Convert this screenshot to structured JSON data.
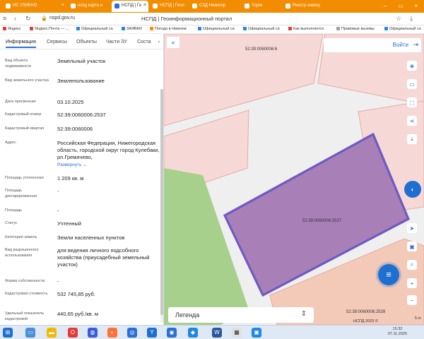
{
  "browser": {
    "tabs": [
      {
        "label": "ИС УЗИКНО"
      },
      {
        "label": "нспд карта н"
      },
      {
        "label": "НСПД | Ге",
        "active": true
      },
      {
        "label": "НСПД | Геоп"
      },
      {
        "label": "СЗД Нижегор"
      },
      {
        "label": "Торги"
      },
      {
        "label": "Реестр извещ"
      }
    ],
    "url": "nspd.gov.ru",
    "page_title": "НСПД | Геоинформационный портал",
    "bookmarks": [
      {
        "label": "Яндекс",
        "color": "#e53935"
      },
      {
        "label": "Яндекс.Почта — ...",
        "color": "#e53935"
      },
      {
        "label": "Официальный са",
        "color": "#1e88e5"
      },
      {
        "label": "ЗАЯВКИ",
        "color": "#1e88e5"
      },
      {
        "label": "Погода в Нижнем",
        "color": "#fb8c00"
      },
      {
        "label": "Официальный са",
        "color": "#1e88e5"
      },
      {
        "label": "Официальный са",
        "color": "#1e88e5"
      },
      {
        "label": "Как выполняется",
        "color": "#e53935"
      },
      {
        "label": "Правовые вызовы",
        "color": "#9e9e9e"
      },
      {
        "label": "Официальный са",
        "color": "#1e88e5"
      }
    ]
  },
  "panel": {
    "tabs": [
      "Информация",
      "Сервисы",
      "Объекты",
      "Части ЗУ",
      "Соста"
    ],
    "more": "›",
    "fields": [
      {
        "label": "Вид объекта недвижимости",
        "value": "Земельный участок"
      },
      {
        "label": "Вид земельного участка",
        "value": "Землепользование"
      },
      {
        "label": "Дата присвоения",
        "value": "03.10.2025"
      },
      {
        "label": "Кадастровый номер",
        "value": "52:39:0060006:2537"
      },
      {
        "label": "Кадастровый квартал",
        "value": "52:39:0060006"
      },
      {
        "label": "Адрес",
        "value": "Российская Федерация, Нижегородская область, городской округ город Кулебаки, рп.Гремячево,",
        "extra": "Развернуть"
      },
      {
        "label": "Площадь уточненная",
        "value": "1 209 кв. м"
      },
      {
        "label": "Площадь декларированная",
        "value": "-"
      },
      {
        "label": "Площадь",
        "value": "-"
      },
      {
        "label": "Статус",
        "value": "Учтенный"
      },
      {
        "label": "Категория земель",
        "value": "Земли населенных пунктов"
      },
      {
        "label": "Вид разрешенного использования",
        "value": "для ведения личного подсобного хозяйства (приусадебный земельный участок)"
      },
      {
        "label": "Форма собственности",
        "value": "-"
      },
      {
        "label": "Кадастровая стоимость",
        "value": "532 745,85 руб."
      },
      {
        "label": "Удельный показатель кадастровой",
        "value": "440,65 руб./кв. м"
      }
    ]
  },
  "map": {
    "login_label": "Войти",
    "collapse_icon": "«",
    "legend_label": "Легенда",
    "parcel_labels": {
      "top": "52:39:0060006:6",
      "selected": "52:39:0060006:2537",
      "bottom": "52:39:0060006:2539"
    },
    "credit": "НСПД 2025 ©",
    "scale": "5 m",
    "tools": [
      "layers-icon",
      "ruler-icon",
      "select-area-icon",
      "share-icon",
      "download-icon"
    ],
    "nav_tools": [
      "locate-icon",
      "print-icon",
      "search-map-icon",
      "zoom-in-icon",
      "zoom-out-icon"
    ],
    "colors": {
      "selected_fill": "#a97fb8",
      "selected_stroke": "#3b5bdb",
      "parcel_fill": "#f6d9d6",
      "green": "#a8d08d",
      "accent": "#1f6fd1"
    }
  },
  "taskbar": {
    "time": "15:32",
    "date": "07.11.2025"
  }
}
